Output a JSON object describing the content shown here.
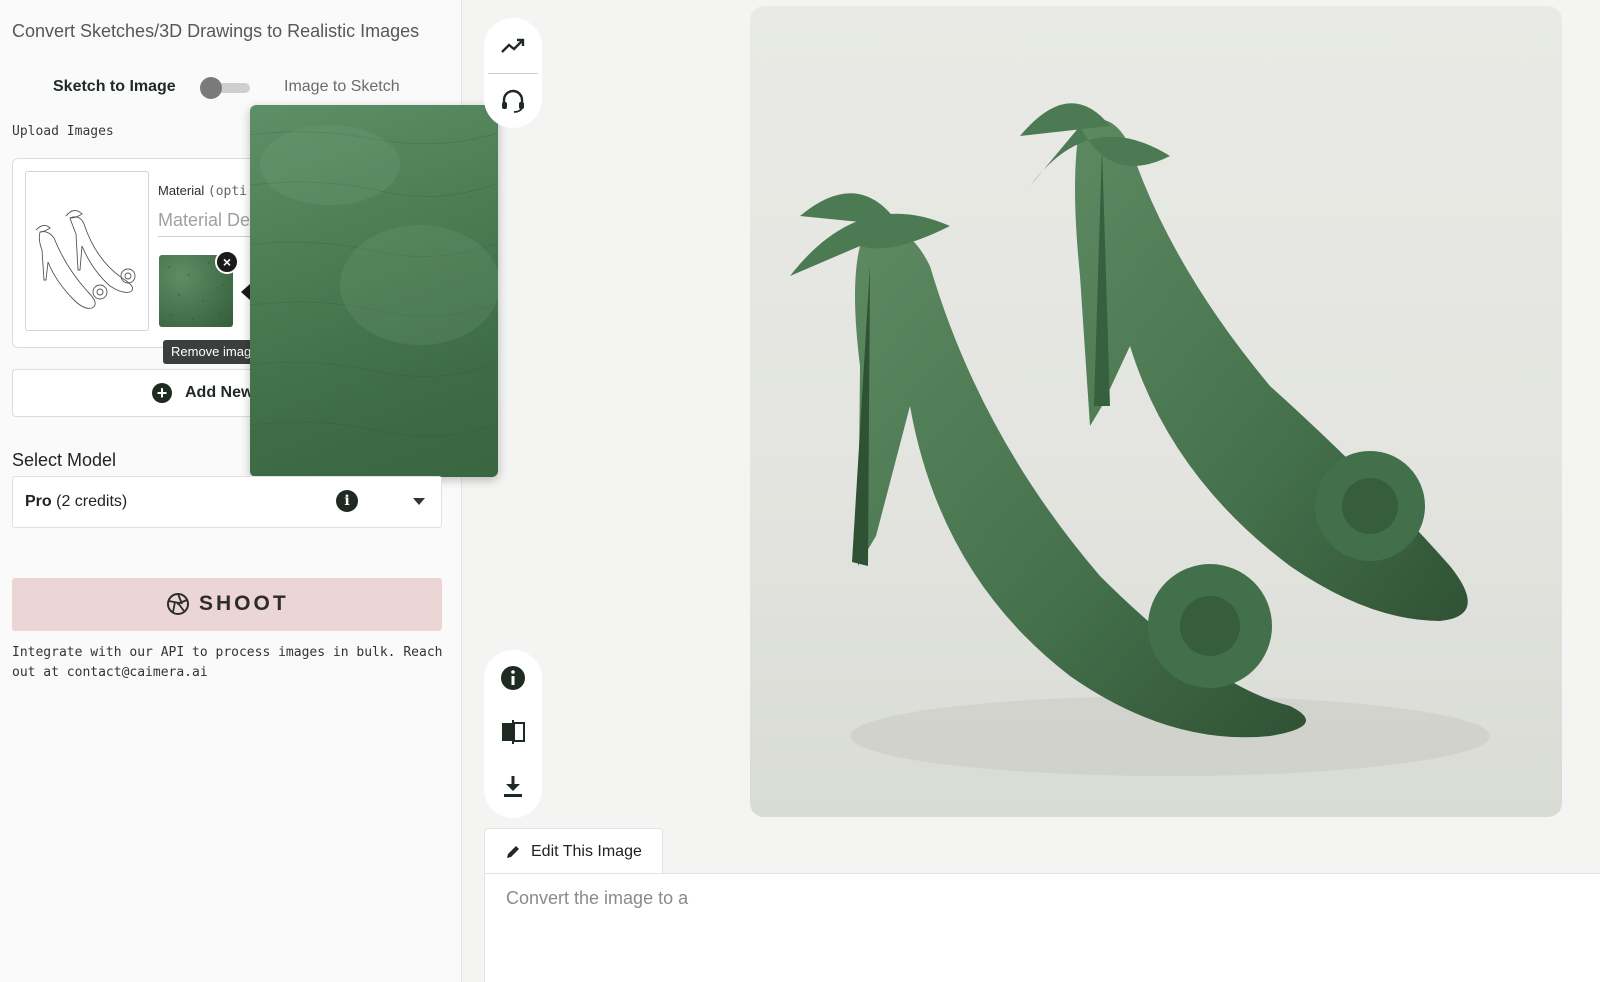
{
  "sidebar": {
    "title": "Convert Sketches/3D Drawings to Realistic Images",
    "mode_left": "Sketch to Image",
    "mode_right": "Image to Sketch",
    "upload_label": "Upload Images",
    "material_label": "Material",
    "material_optional": "(opti",
    "material_placeholder": "Material De",
    "remove_tooltip": "Remove image",
    "remove_glyph": "×",
    "add_new_label": "Add New",
    "add_glyph": "+",
    "select_model_label": "Select Model",
    "model_name": "Pro",
    "model_credits": "(2 credits)",
    "info_glyph": "i",
    "shoot_label": "SHOOT",
    "api_note": "Integrate with our API to process images in bulk. Reach out at contact@caimera.ai"
  },
  "toolbar": {
    "top_icons": [
      "trending-up-icon",
      "headset-icon"
    ],
    "bottom_icons": [
      "info-icon",
      "compare-icon",
      "download-icon"
    ]
  },
  "editor": {
    "tab_label": "Edit This Image",
    "prompt_text": "Convert the image to a"
  },
  "colors": {
    "accent_dark": "#1f2a22",
    "shoot_bg": "#ecd5d5",
    "material_green": "#4b7c52"
  }
}
